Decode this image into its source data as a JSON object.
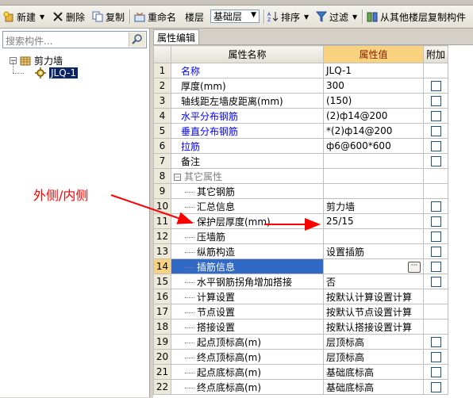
{
  "toolbar": {
    "new_label": "新建",
    "delete_label": "删除",
    "copy_label": "复制",
    "rename_label": "重命名",
    "floor_label": "楼层",
    "floor_value": "基础层",
    "sort_label": "排序",
    "filter_label": "过滤",
    "copy_from_label": "从其他楼层复制构件"
  },
  "left_panel": {
    "search_placeholder": "搜索构件...",
    "tree_root": "剪力墙",
    "tree_child": "JLQ-1"
  },
  "property_panel": {
    "tab_label": "属性编辑",
    "columns": {
      "name": "属性名称",
      "value": "属性值",
      "extra": "附加"
    },
    "rows": [
      {
        "num": "1",
        "name": "名称",
        "value": "JLQ-1",
        "blue": true,
        "checkbox": false
      },
      {
        "num": "2",
        "name": "厚度(mm)",
        "value": "300",
        "blue": false,
        "checkbox": true
      },
      {
        "num": "3",
        "name": "轴线距左墙皮距离(mm)",
        "value": "(150)",
        "blue": false,
        "checkbox": true
      },
      {
        "num": "4",
        "name": "水平分布钢筋",
        "value": "(2)ф14@200",
        "blue": true,
        "checkbox": true
      },
      {
        "num": "5",
        "name": "垂直分布钢筋",
        "value": "*(2)ф14@200",
        "blue": true,
        "checkbox": true
      },
      {
        "num": "6",
        "name": "拉筋",
        "value": "ф6@600*600",
        "blue": true,
        "checkbox": true
      },
      {
        "num": "7",
        "name": "备注",
        "value": "",
        "blue": false,
        "checkbox": true
      },
      {
        "num": "8",
        "name": "其它属性",
        "value": "",
        "group": true,
        "checkbox": false
      },
      {
        "num": "9",
        "name": "其它钢筋",
        "value": "",
        "child": true,
        "checkbox": false
      },
      {
        "num": "10",
        "name": "汇总信息",
        "value": "剪力墙",
        "child": true,
        "checkbox": true
      },
      {
        "num": "11",
        "name": "保护层厚度(mm)",
        "value": "25/15",
        "child": true,
        "checkbox": true
      },
      {
        "num": "12",
        "name": "压墙筋",
        "value": "",
        "child": true,
        "checkbox": true
      },
      {
        "num": "13",
        "name": "纵筋构造",
        "value": "设置插筋",
        "child": true,
        "checkbox": true
      },
      {
        "num": "14",
        "name": "插筋信息",
        "value": "",
        "child": true,
        "checkbox": true,
        "selected": true
      },
      {
        "num": "15",
        "name": "水平钢筋拐角增加搭接",
        "value": "否",
        "child": true,
        "checkbox": true
      },
      {
        "num": "16",
        "name": "计算设置",
        "value": "按默认计算设置计算",
        "child": true,
        "checkbox": false
      },
      {
        "num": "17",
        "name": "节点设置",
        "value": "按默认节点设置计算",
        "child": true,
        "checkbox": false
      },
      {
        "num": "18",
        "name": "搭接设置",
        "value": "按默认搭接设置计算",
        "child": true,
        "checkbox": false
      },
      {
        "num": "19",
        "name": "起点顶标高(m)",
        "value": "层顶标高",
        "child": true,
        "checkbox": true
      },
      {
        "num": "20",
        "name": "终点顶标高(m)",
        "value": "层顶标高",
        "child": true,
        "checkbox": true
      },
      {
        "num": "21",
        "name": "起点底标高(m)",
        "value": "基础底标高",
        "child": true,
        "checkbox": true
      },
      {
        "num": "22",
        "name": "终点底标高(m)",
        "value": "基础底标高",
        "child": true,
        "checkbox": true
      }
    ]
  },
  "annotation": {
    "text": "外侧/内侧",
    "color": "#ff0000"
  },
  "colors": {
    "selected_row": "#3169c6",
    "value_header": "#f9d27f",
    "blue_text": "#0000ff"
  }
}
